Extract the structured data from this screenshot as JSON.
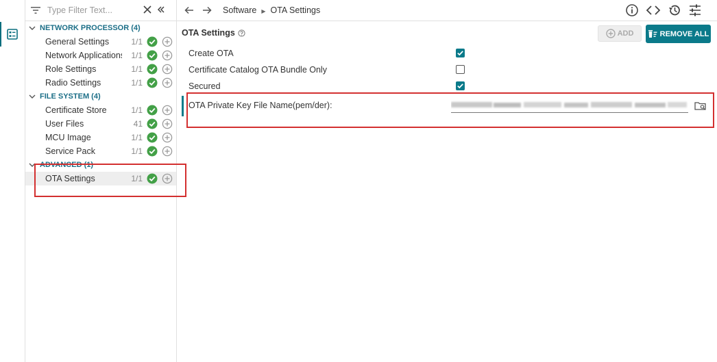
{
  "left_rail": {
    "icon": "outline-view-icon"
  },
  "tree": {
    "filter_placeholder": "Type Filter Text...",
    "groups": [
      {
        "label": "NETWORK PROCESSOR (4)",
        "items": [
          {
            "label": "General Settings",
            "count": "1/1"
          },
          {
            "label": "Network Applications",
            "count": "1/1"
          },
          {
            "label": "Role Settings",
            "count": "1/1"
          },
          {
            "label": "Radio Settings",
            "count": "1/1"
          }
        ]
      },
      {
        "label": "FILE SYSTEM (4)",
        "items": [
          {
            "label": "Certificate Store",
            "count": "1/1"
          },
          {
            "label": "User Files",
            "count": "41"
          },
          {
            "label": "MCU Image",
            "count": "1/1"
          },
          {
            "label": "Service Pack",
            "count": "1/1"
          }
        ]
      },
      {
        "label": "ADVANCED (1)",
        "items": [
          {
            "label": "OTA Settings",
            "count": "1/1",
            "selected": true
          }
        ]
      }
    ]
  },
  "breadcrumb": {
    "root": "Software",
    "current": "OTA Settings"
  },
  "toolbar": {
    "icons": [
      "info-icon",
      "code-icon",
      "history-icon",
      "settings-sliders-icon"
    ]
  },
  "panel": {
    "title": "OTA Settings",
    "add_label": "ADD",
    "remove_all_label": "REMOVE ALL",
    "fields": [
      {
        "label": "Create OTA",
        "checked": true
      },
      {
        "label": "Certificate Catalog OTA Bundle Only",
        "checked": false
      },
      {
        "label": "Secured",
        "checked": true
      }
    ],
    "key_file_label": "OTA Private Key File Name(pem/der):"
  },
  "colors": {
    "accent": "#0b7a8a",
    "group_text": "#1b6e87",
    "success": "#43a047",
    "highlight_box": "#d32f2f"
  }
}
